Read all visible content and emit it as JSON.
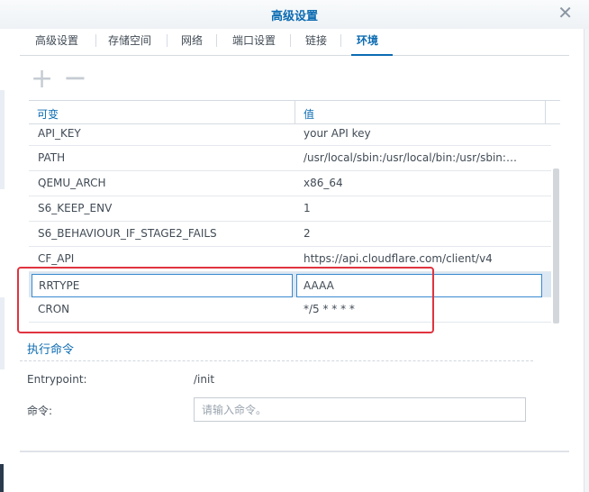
{
  "window": {
    "title": "高级设置"
  },
  "tabs": [
    {
      "label": "高级设置"
    },
    {
      "label": "存储空间"
    },
    {
      "label": "网络"
    },
    {
      "label": "端口设置"
    },
    {
      "label": "链接"
    },
    {
      "label": "环境"
    }
  ],
  "active_tab": "环境",
  "toolbar": {
    "add_icon": "plus-icon",
    "remove_icon": "minus-icon"
  },
  "grid": {
    "headers": {
      "variable": "可变",
      "value": "值"
    },
    "rows": [
      {
        "key": "API_KEY",
        "value": "your API key"
      },
      {
        "key": "PATH",
        "value": "/usr/local/sbin:/usr/local/bin:/usr/sbin:/usr/bin:/sbin:/bin"
      },
      {
        "key": "QEMU_ARCH",
        "value": "x86_64"
      },
      {
        "key": "S6_KEEP_ENV",
        "value": "1"
      },
      {
        "key": "S6_BEHAVIOUR_IF_STAGE2_FAILS",
        "value": "2"
      },
      {
        "key": "CF_API",
        "value": "https://api.cloudflare.com/client/v4"
      },
      {
        "key": "RRTYPE",
        "value": "AAAA"
      },
      {
        "key": "CRON",
        "value": "*/5 * * * *"
      }
    ]
  },
  "execute": {
    "title": "执行命令",
    "entrypoint_label": "Entrypoint:",
    "entrypoint_value": "/init",
    "command_label": "命令:",
    "command_placeholder": "请输入命令。",
    "command_value": ""
  },
  "colors": {
    "accent": "#0b6bb2",
    "highlight": "#e0343f",
    "editing_row": "#dbe7f3"
  }
}
